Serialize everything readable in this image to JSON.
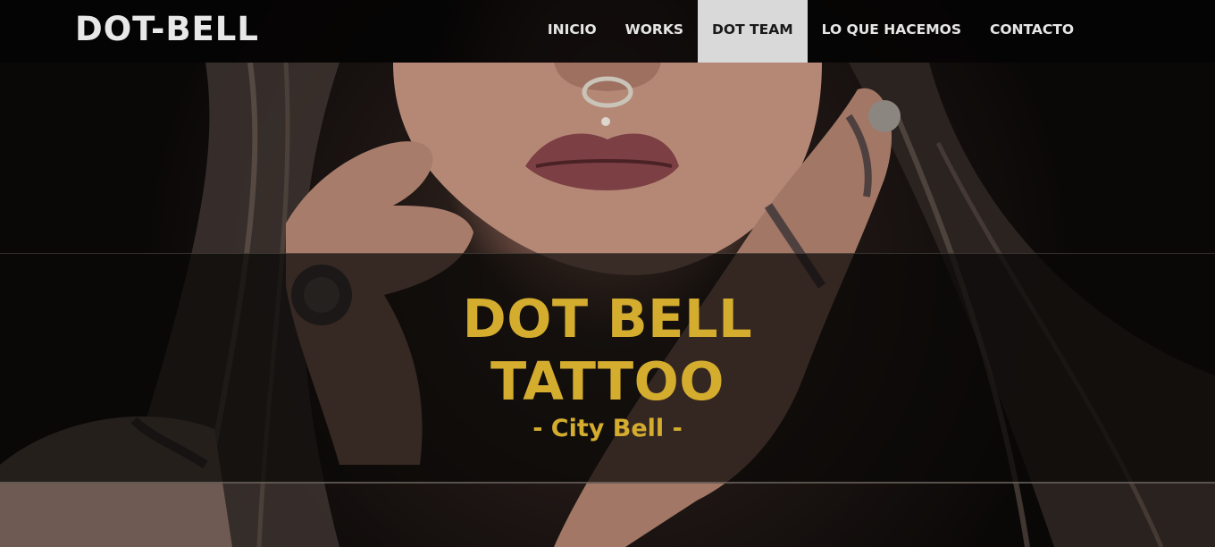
{
  "brand": {
    "name": "DOT-BELL"
  },
  "nav": {
    "items": [
      {
        "label": "INICIO"
      },
      {
        "label": "WORKS"
      },
      {
        "label": "DOT TEAM"
      },
      {
        "label": "LO QUE HACEMOS"
      },
      {
        "label": "CONTACTO"
      }
    ],
    "active_index": 2
  },
  "hero": {
    "title_line1": "DOT BELL",
    "title_line2": "TATTOO",
    "subtitle": "- City Bell -",
    "image": "tattooed-woman-portrait"
  },
  "colors": {
    "accent": "#d4ad2f",
    "navbar_bg": "#050404",
    "nav_active_bg": "#d9d9d9",
    "nav_text": "#e6e6e6"
  }
}
